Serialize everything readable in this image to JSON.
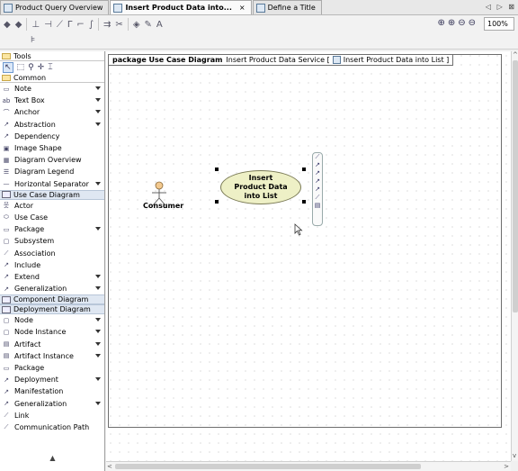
{
  "tabs": [
    {
      "label": "Product Query Overview",
      "active": false
    },
    {
      "label": "Insert Product Data into...",
      "active": true
    },
    {
      "label": "Define a Title",
      "active": false
    }
  ],
  "tab_nav": "◁ ▷ ⊠",
  "zoom": "100%",
  "palette": {
    "tools_label": "Tools",
    "common_label": "Common",
    "sections": [
      {
        "label": "",
        "items": [
          {
            "label": "Note",
            "icon": "note-icon",
            "has_arrow": true
          },
          {
            "label": "Text Box",
            "icon": "text-box-icon",
            "has_arrow": true
          },
          {
            "label": "Anchor",
            "icon": "anchor-icon",
            "has_arrow": true
          },
          {
            "label": "Abstraction",
            "icon": "abstraction-icon",
            "has_arrow": true
          },
          {
            "label": "Dependency",
            "icon": "dependency-icon",
            "has_arrow": false
          },
          {
            "label": "Image Shape",
            "icon": "image-icon",
            "has_arrow": false
          },
          {
            "label": "Diagram Overview",
            "icon": "diagram-overview-icon",
            "has_arrow": false
          },
          {
            "label": "Diagram Legend",
            "icon": "diagram-legend-icon",
            "has_arrow": false
          },
          {
            "label": "Horizontal Separator",
            "icon": "separator-icon",
            "has_arrow": true
          }
        ]
      },
      {
        "label": "Use Case Diagram",
        "items": [
          {
            "label": "Actor",
            "icon": "actor-icon",
            "has_arrow": false
          },
          {
            "label": "Use Case",
            "icon": "use-case-icon",
            "has_arrow": false
          },
          {
            "label": "Package",
            "icon": "package-icon",
            "has_arrow": true
          },
          {
            "label": "Subsystem",
            "icon": "subsystem-icon",
            "has_arrow": false
          },
          {
            "label": "Association",
            "icon": "association-icon",
            "has_arrow": false
          },
          {
            "label": "Include",
            "icon": "include-icon",
            "has_arrow": false
          },
          {
            "label": "Extend",
            "icon": "extend-icon",
            "has_arrow": true
          },
          {
            "label": "Generalization",
            "icon": "generalization-icon",
            "has_arrow": true
          }
        ]
      },
      {
        "label": "Component Diagram",
        "items": []
      },
      {
        "label": "Deployment Diagram",
        "items": [
          {
            "label": "Node",
            "icon": "node-icon",
            "has_arrow": true
          },
          {
            "label": "Node Instance",
            "icon": "node-instance-icon",
            "has_arrow": true
          },
          {
            "label": "Artifact",
            "icon": "artifact-icon",
            "has_arrow": true
          },
          {
            "label": "Artifact Instance",
            "icon": "artifact-instance-icon",
            "has_arrow": true
          },
          {
            "label": "Package",
            "icon": "package-icon",
            "has_arrow": false
          },
          {
            "label": "Deployment",
            "icon": "deployment-icon",
            "has_arrow": true
          },
          {
            "label": "Manifestation",
            "icon": "manifestation-icon",
            "has_arrow": false
          },
          {
            "label": "Generalization",
            "icon": "generalization-icon",
            "has_arrow": true
          },
          {
            "label": "Link",
            "icon": "link-icon",
            "has_arrow": false
          },
          {
            "label": "Communication Path",
            "icon": "communication-path-icon",
            "has_arrow": false
          }
        ]
      }
    ]
  },
  "diagram": {
    "frame_keyword": "package Use Case Diagram",
    "frame_name": "Insert Product Data Service [",
    "frame_ref": "Insert Product Data into List ]",
    "actor_label": "Consumer",
    "use_case_label": "Insert Product Data into List"
  },
  "colors": {
    "use_case_fill": "#eef0c6",
    "actor_head": "#f3c98f",
    "active_tab": "#fafafa"
  }
}
